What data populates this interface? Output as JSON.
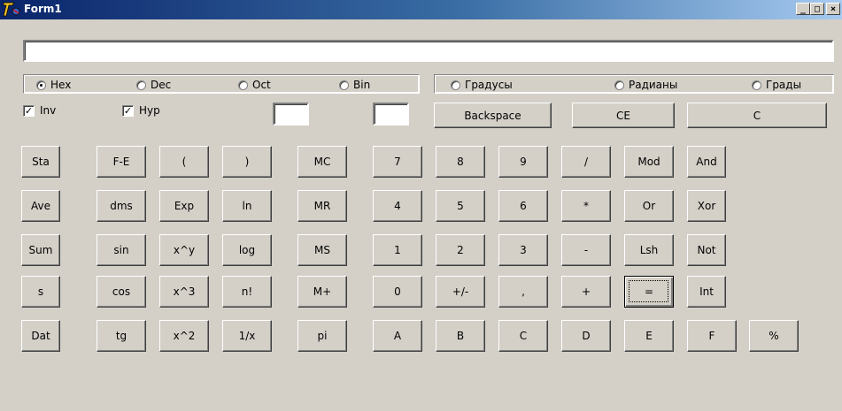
{
  "window": {
    "title": "Form1",
    "minimize": "_",
    "maximize": "□",
    "close": "×"
  },
  "display": {
    "value": ""
  },
  "base_group": [
    {
      "label": "Hex",
      "checked": true
    },
    {
      "label": "Dec",
      "checked": false
    },
    {
      "label": "Oct",
      "checked": false
    },
    {
      "label": "Bin",
      "checked": false
    }
  ],
  "angle_group": [
    {
      "label": "Градусы",
      "checked": false
    },
    {
      "label": "Радианы",
      "checked": false
    },
    {
      "label": "Грады",
      "checked": false
    }
  ],
  "checks": [
    {
      "label": "Inv",
      "checked": true,
      "mark": "✓"
    },
    {
      "label": "Hyp",
      "checked": true,
      "mark": "✓"
    }
  ],
  "edit_buttons": {
    "backspace": "Backspace",
    "ce": "CE",
    "c": "C"
  },
  "keys": {
    "col1": [
      "Sta",
      "Ave",
      "Sum",
      "s",
      "Dat"
    ],
    "col2": [
      "F-E",
      "dms",
      "sin",
      "cos",
      "tg"
    ],
    "col3": [
      "(",
      "Exp",
      "x^y",
      "x^3",
      "x^2"
    ],
    "col4": [
      ")",
      "ln",
      "log",
      "n!",
      "1/x"
    ],
    "mem": [
      "MC",
      "MR",
      "MS",
      "M+",
      "pi"
    ],
    "grid": [
      [
        "7",
        "8",
        "9",
        "/",
        "Mod",
        "And"
      ],
      [
        "4",
        "5",
        "6",
        "*",
        "Or",
        "Xor"
      ],
      [
        "1",
        "2",
        "3",
        "-",
        "Lsh",
        "Not"
      ],
      [
        "0",
        "+/-",
        ",",
        "+",
        "=",
        "Int"
      ],
      [
        "A",
        "B",
        "C",
        "D",
        "E",
        "F",
        "%"
      ]
    ]
  }
}
